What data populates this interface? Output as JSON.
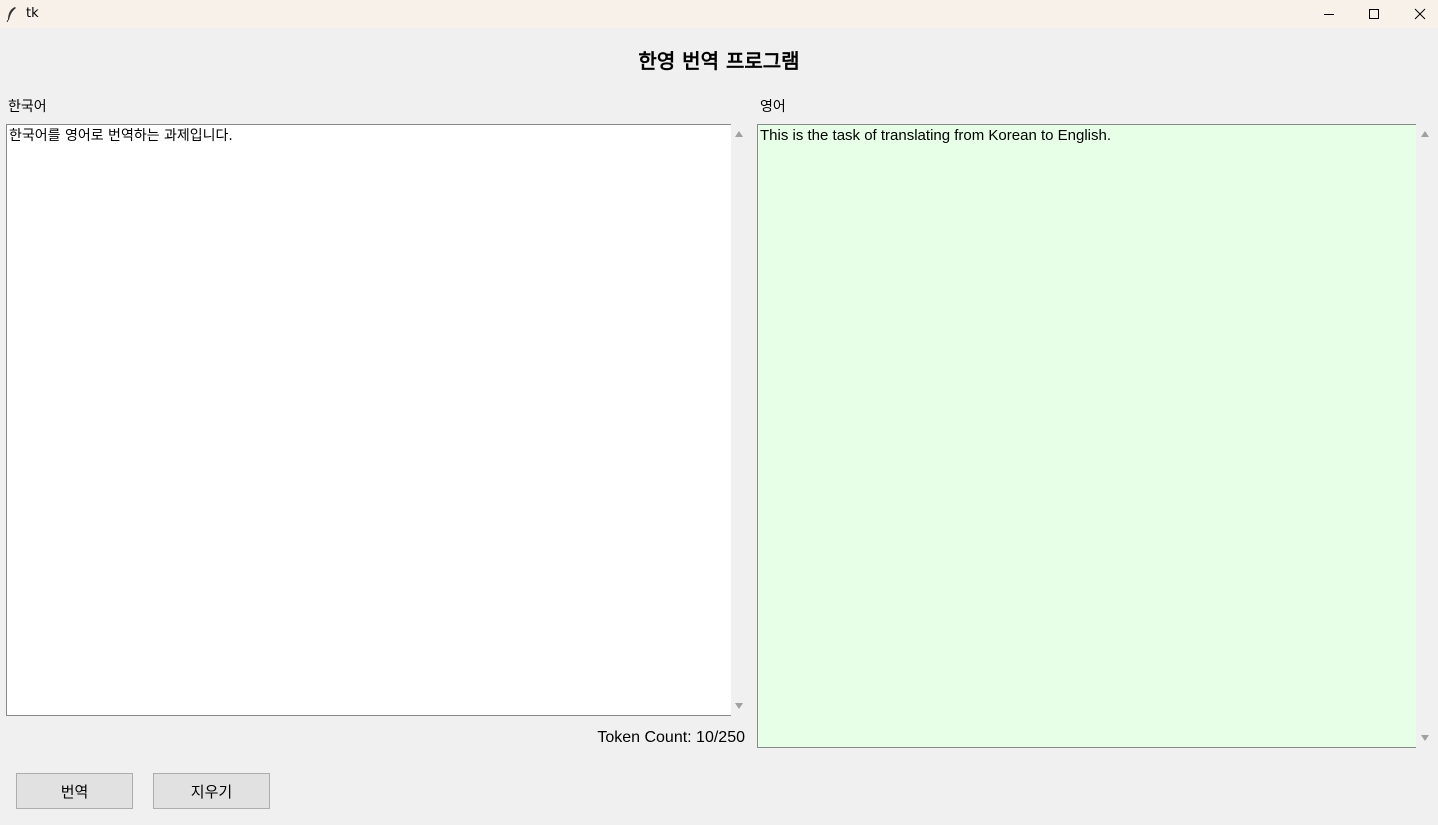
{
  "window": {
    "title": "tk",
    "icons": {
      "app": "feather-icon",
      "minimize": "minimize-icon",
      "maximize": "maximize-icon",
      "close": "close-icon"
    }
  },
  "heading": "한영 번역 프로그램",
  "korean_pane": {
    "label": "한국어",
    "text": "한국어를 영어로 번역하는 과제입니다.",
    "background": "#ffffff"
  },
  "english_pane": {
    "label": "영어",
    "text": "This is the task of translating from Korean to English.",
    "background": "#e6ffe6"
  },
  "token_count": "Token Count: 10/250",
  "buttons": {
    "translate": "번역",
    "clear": "지우기"
  }
}
